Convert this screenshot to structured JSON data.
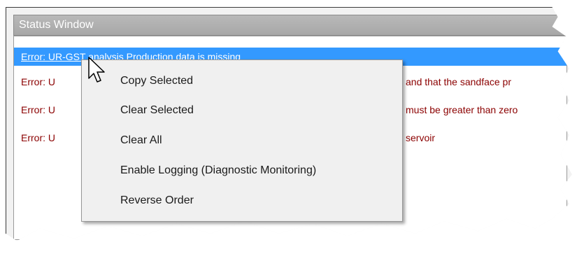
{
  "window": {
    "title": "Status Window"
  },
  "status_rows": [
    {
      "text": "Error: UR-GST analysis Production data is missing",
      "tail": "",
      "selected": true
    },
    {
      "text": "Error: U",
      "tail": "and that the sandface pr",
      "selected": false
    },
    {
      "text": "Error: U",
      "tail": "must be greater than zero",
      "selected": false
    },
    {
      "text": "Error: U",
      "tail": "servoir",
      "selected": false
    }
  ],
  "context_menu": {
    "items": [
      {
        "label": "Copy Selected"
      },
      {
        "label": "Clear Selected"
      },
      {
        "label": "Clear All"
      },
      {
        "label": "Enable Logging (Diagnostic Monitoring)"
      },
      {
        "label": "Reverse Order"
      }
    ]
  },
  "colors": {
    "error_text": "#8b0000",
    "selection": "#3399ff",
    "titlebar": "#a7a7a7"
  },
  "icons": {
    "cursor": "mouse-pointer-icon"
  }
}
